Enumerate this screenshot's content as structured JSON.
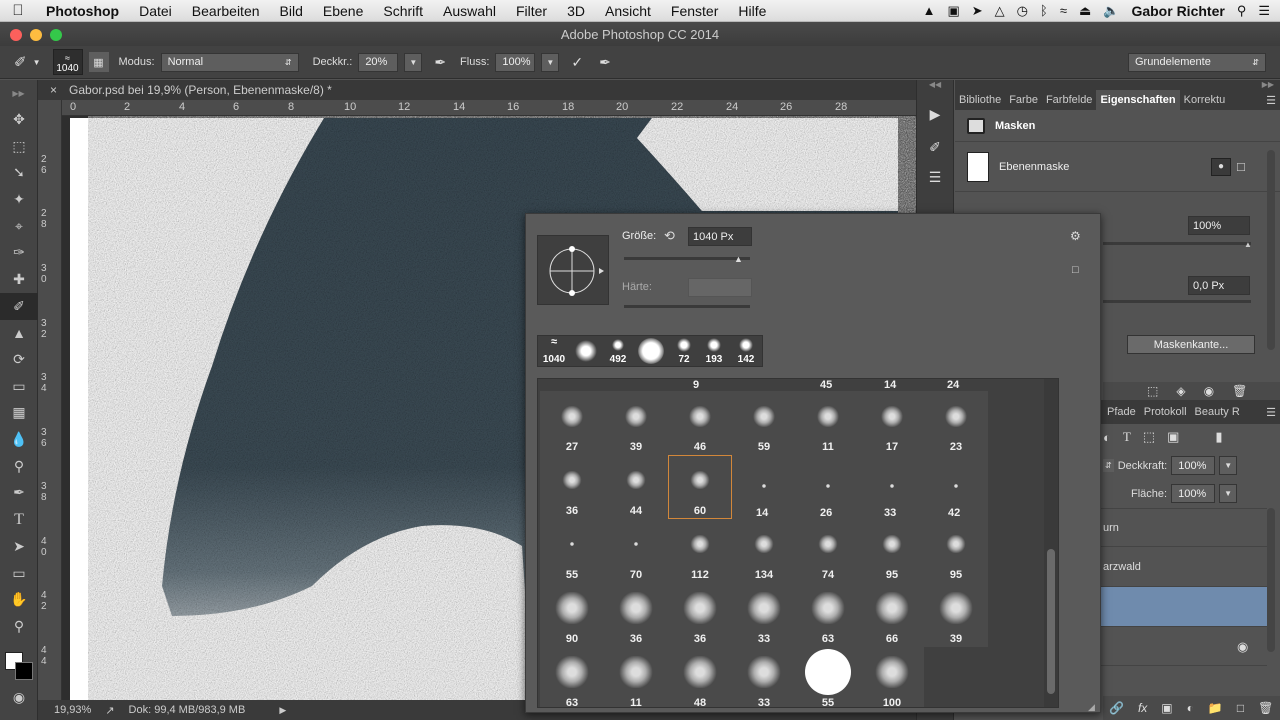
{
  "menubar": {
    "app": "Photoshop",
    "items": [
      "Datei",
      "Bearbeiten",
      "Bild",
      "Ebene",
      "Schrift",
      "Auswahl",
      "Filter",
      "3D",
      "Ansicht",
      "Fenster",
      "Hilfe"
    ],
    "user": "Gabor Richter"
  },
  "window": {
    "title": "Adobe Photoshop CC 2014"
  },
  "options": {
    "brush_size": "1040",
    "mode_label": "Modus:",
    "mode_value": "Normal",
    "opacity_label": "Deckkr.:",
    "opacity_value": "20%",
    "flow_label": "Fluss:",
    "flow_value": "100%",
    "workspace": "Grundelemente"
  },
  "document": {
    "tab": "Gabor.psd bei 19,9% (Person, Ebenenmaske/8) *",
    "ruler_h": [
      "0",
      "2",
      "4",
      "6",
      "8",
      "10",
      "12",
      "14",
      "16",
      "18",
      "20",
      "22",
      "24",
      "26",
      "28"
    ],
    "ruler_v": [
      "2\n6",
      "2\n8",
      "3\n0",
      "3\n2",
      "3\n4",
      "3\n6",
      "3\n8",
      "4\n0",
      "4\n2",
      "4\n4",
      "4\n6"
    ],
    "zoom": "19,93%",
    "doc_info": "Dok: 99,4 MB/983,9 MB"
  },
  "properties": {
    "tabs": [
      "Bibliothe",
      "Farbe",
      "Farbfelde",
      "Eigenschaften",
      "Korrektu"
    ],
    "active_tab": "Eigenschaften",
    "section": "Masken",
    "mask_label": "Ebenenmaske",
    "density": "100%",
    "feather": "0,0 Px",
    "mask_edge_button": "Maskenkante..."
  },
  "layers": {
    "tabs": [
      "Pfade",
      "Protokoll",
      "Beauty R"
    ],
    "opacity_label": "Deckkraft:",
    "opacity_value": "100%",
    "fill_label": "Fläche:",
    "fill_value": "100%",
    "rows": [
      "urn",
      "arzwald"
    ]
  },
  "picker": {
    "size_label": "Größe:",
    "size_value": "1040 Px",
    "hardness_label": "Härte:",
    "recent": [
      "1040",
      "",
      "492",
      "",
      "72",
      "193",
      "142"
    ],
    "top_row_labels": [
      "9",
      "45",
      "14",
      "24"
    ],
    "grid": [
      [
        "27",
        "39",
        "46",
        "59",
        "11",
        "17",
        "23"
      ],
      [
        "36",
        "44",
        "60",
        "",
        "",
        "",
        ""
      ],
      [
        "",
        "",
        "",
        "14",
        "26",
        "33",
        "42"
      ],
      [
        "55",
        "70",
        "112",
        "134",
        "74",
        "95",
        "95"
      ],
      [
        "90",
        "36",
        "36",
        "33",
        "63",
        "66",
        "39"
      ],
      [
        "63",
        "11",
        "48",
        "33",
        "55",
        "100"
      ]
    ],
    "selected": "60"
  },
  "colors": {
    "ui_dark": "#3a3a3a",
    "ui_mid": "#535353",
    "accent_selected": "#d2873a",
    "layer_selected": "#6f8bad"
  }
}
